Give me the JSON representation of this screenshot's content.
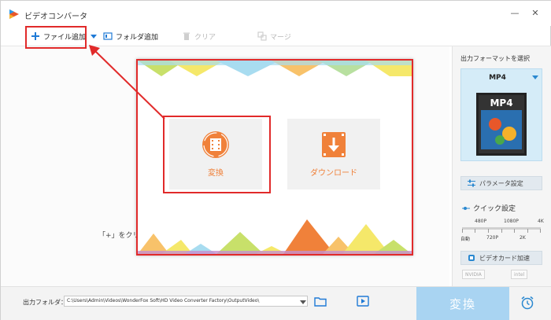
{
  "app": {
    "title": "ビデオコンバータ"
  },
  "window_controls": {
    "minimize": "—",
    "close": "✕"
  },
  "toolbar": {
    "add_file": "ファイル追加",
    "add_folder": "フォルダ追加",
    "clear": "クリア",
    "merge": "マージ"
  },
  "main": {
    "hint": "「+」をクリッ",
    "cards": {
      "convert_label": "変換",
      "download_label": "ダウンロード"
    }
  },
  "right_panel": {
    "title": "出力フォーマットを選択",
    "format_name": "MP4",
    "format_image_text": "MP4",
    "parameter_settings": "パラメータ設定",
    "quick_settings": "クイック設定",
    "quick_top_labels": [
      "480P",
      "1080P",
      "4K"
    ],
    "quick_bottom_labels": [
      "自動",
      "720P",
      "2K"
    ],
    "gpu_accel": "ビデオカード加速",
    "chips": [
      "NVIDIA",
      "intel"
    ]
  },
  "bottom": {
    "output_folder_label": "出力フォルダ：",
    "output_path": "C:\\Users\\Admin\\Videos\\WonderFox Soft\\HD Video Converter Factory\\OutputVideo\\",
    "convert_button": "変換"
  },
  "colors": {
    "accent_orange": "#f0813a",
    "highlight_red": "#e12a2a",
    "convert_blue": "#a9d4f2",
    "toolbar_blue": "#1f7ad6"
  }
}
